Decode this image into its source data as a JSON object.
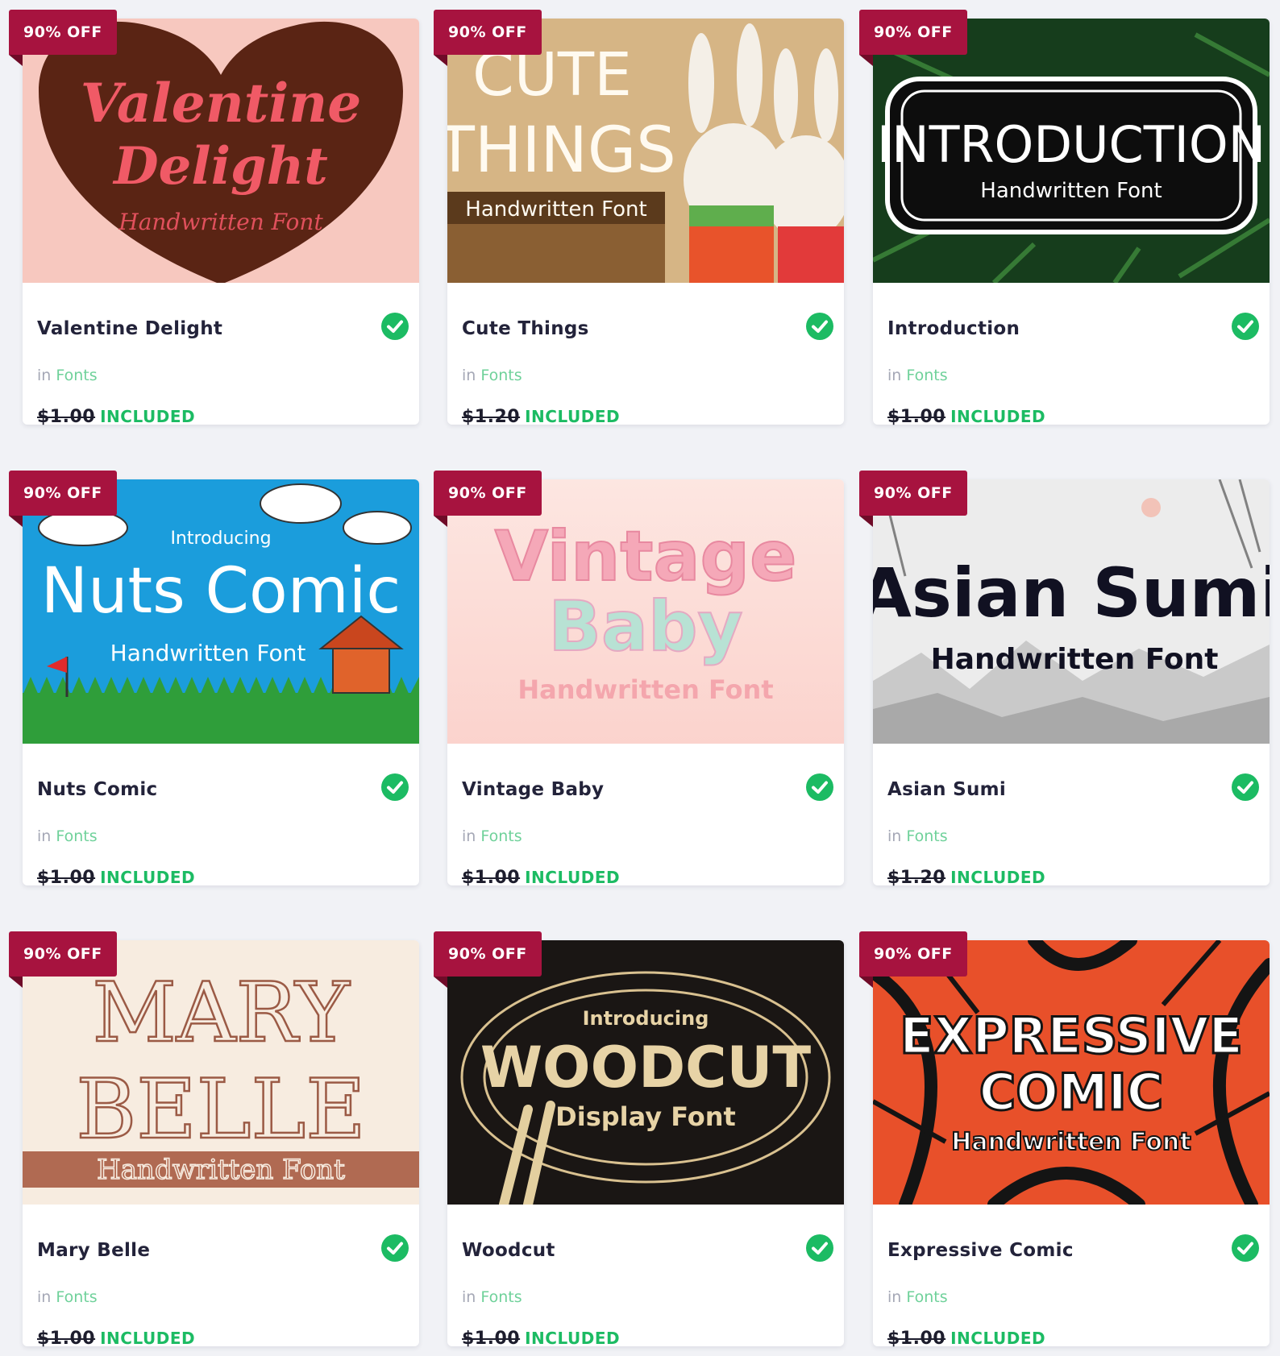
{
  "badge_text": "90% OFF",
  "category_prefix": "in",
  "colors": {
    "badge": "#a7133f",
    "included": "#1cbb63",
    "check": "#1cbb63",
    "category_link": "#6fd19a"
  },
  "products": [
    {
      "name": "Valentine Delight",
      "category": "Fonts",
      "old_price": "$1.00",
      "status": "INCLUDED",
      "thumb": {
        "line1": "Valentine",
        "line2": "Delight",
        "sub": "Handwritten Font"
      }
    },
    {
      "name": "Cute Things",
      "category": "Fonts",
      "old_price": "$1.20",
      "status": "INCLUDED",
      "thumb": {
        "line1": "CUTE",
        "line2": "THINGS",
        "sub": "Handwritten Font"
      }
    },
    {
      "name": "Introduction",
      "category": "Fonts",
      "old_price": "$1.00",
      "status": "INCLUDED",
      "thumb": {
        "line1": "INTRODUCTION",
        "sub": "Handwritten Font"
      }
    },
    {
      "name": "Nuts Comic",
      "category": "Fonts",
      "old_price": "$1.00",
      "status": "INCLUDED",
      "thumb": {
        "intro": "Introducing",
        "line1": "Nuts Comic",
        "sub": "Handwritten Font"
      }
    },
    {
      "name": "Vintage Baby",
      "category": "Fonts",
      "old_price": "$1.00",
      "status": "INCLUDED",
      "thumb": {
        "line1": "Vintage",
        "line2": "Baby",
        "sub": "Handwritten Font"
      }
    },
    {
      "name": "Asian Sumi",
      "category": "Fonts",
      "old_price": "$1.20",
      "status": "INCLUDED",
      "thumb": {
        "line1": "Asian Sumi",
        "sub": "Handwritten Font"
      }
    },
    {
      "name": "Mary Belle",
      "category": "Fonts",
      "old_price": "$1.00",
      "status": "INCLUDED",
      "thumb": {
        "line1": "MARY",
        "line2": "BELLE",
        "sub": "Handwritten Font"
      }
    },
    {
      "name": "Woodcut",
      "category": "Fonts",
      "old_price": "$1.00",
      "status": "INCLUDED",
      "thumb": {
        "intro": "Introducing",
        "line1": "WOODCUT",
        "sub": "Display Font"
      }
    },
    {
      "name": "Expressive Comic",
      "category": "Fonts",
      "old_price": "$1.00",
      "status": "INCLUDED",
      "thumb": {
        "line1": "EXPRESSIVE",
        "line2": "COMIC",
        "sub": "Handwritten Font"
      }
    }
  ]
}
